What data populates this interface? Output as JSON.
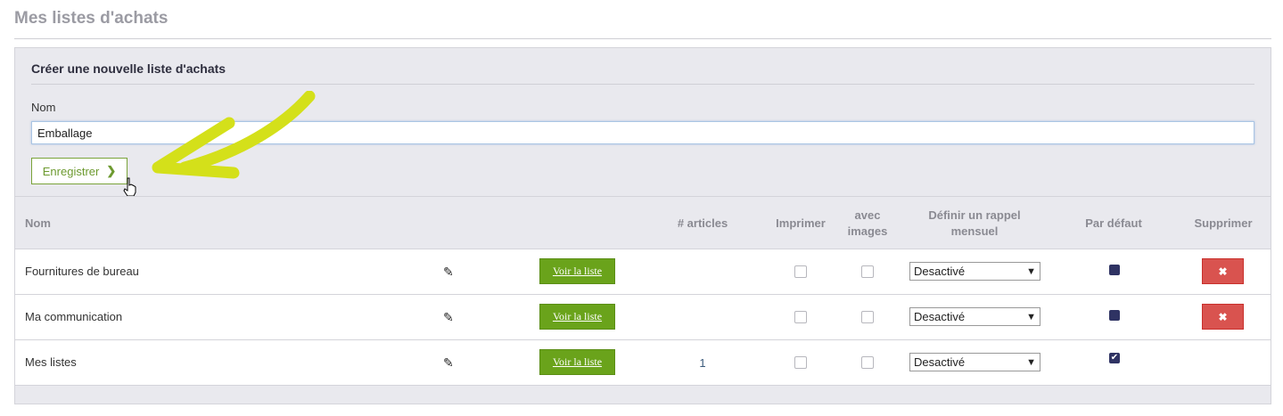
{
  "page": {
    "title": "Mes listes d'achats"
  },
  "create_form": {
    "heading": "Créer une nouvelle liste d'achats",
    "name_label": "Nom",
    "name_value": "Emballage",
    "save_label": "Enregistrer",
    "save_icon": "chevron-right-icon"
  },
  "table": {
    "headers": {
      "name": "Nom",
      "articles": "# articles",
      "print": "Imprimer",
      "images_line1": "avec",
      "images_line2": "images",
      "reminder_line1": "Définir un rappel",
      "reminder_line2": "mensuel",
      "default": "Par défaut",
      "delete": "Supprimer"
    },
    "rows": [
      {
        "name": "Fournitures de bureau",
        "view_label": "Voir la liste",
        "count": "",
        "reminder": "Desactivé",
        "is_default": false,
        "delete_icon": "close-icon"
      },
      {
        "name": "Ma communication",
        "view_label": "Voir la liste",
        "count": "",
        "reminder": "Desactivé",
        "is_default": false,
        "delete_icon": "close-icon"
      },
      {
        "name": "Mes listes",
        "view_label": "Voir la liste",
        "count": "1",
        "reminder": "Desactivé",
        "is_default": true
      }
    ]
  },
  "colors": {
    "accent_green": "#6aa31b",
    "delete_red": "#d9534f",
    "default_navy": "#2f3363",
    "annotation_arrow": "#d4e01a"
  }
}
